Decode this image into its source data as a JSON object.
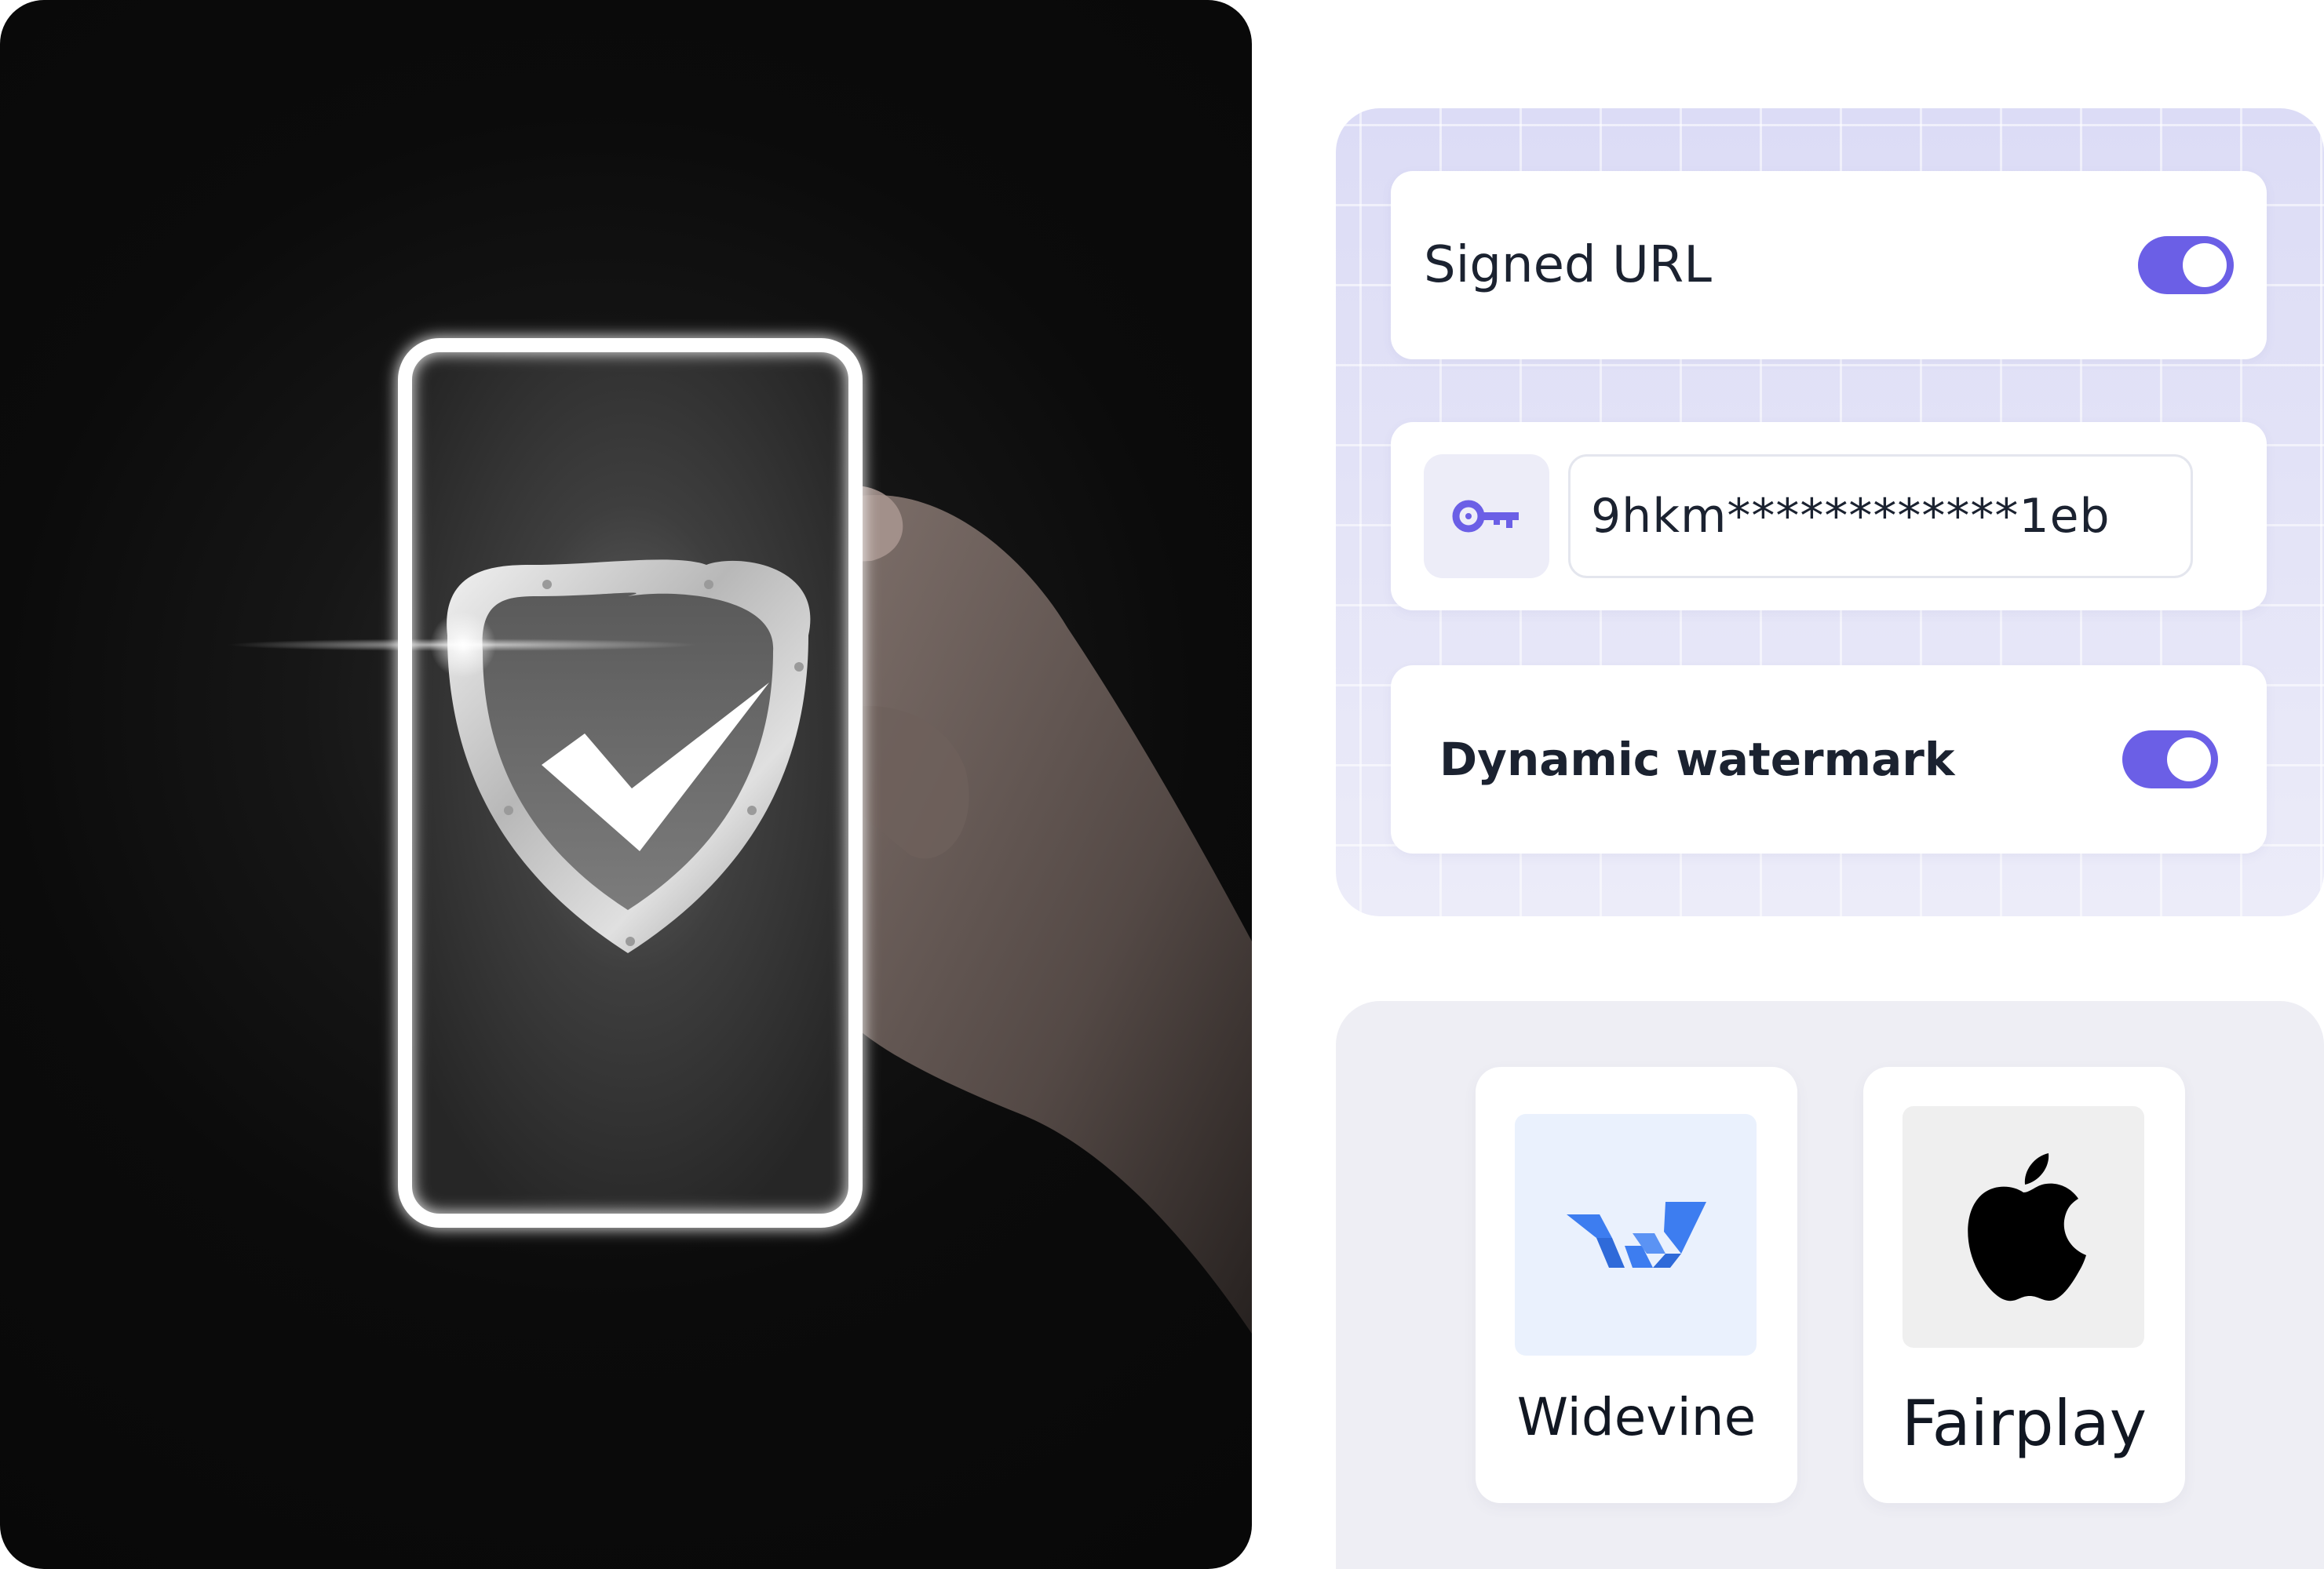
{
  "security": {
    "signed_url": {
      "label": "Signed URL",
      "enabled": true
    },
    "api_key": {
      "icon": "key-icon",
      "value": "9hkm************1eb"
    },
    "dynamic_watermark": {
      "label": "Dynamic watermark",
      "enabled": true
    }
  },
  "drm": {
    "providers": [
      {
        "name": "Widevine",
        "icon": "widevine-logo-icon"
      },
      {
        "name": "Fairplay",
        "icon": "apple-logo-icon"
      }
    ]
  },
  "colors": {
    "accent": "#6b5fe6",
    "hero_background": "#0b0b0b",
    "settings_panel_bg": "#e2e2f7",
    "drm_panel_bg": "#eeeef4",
    "widevine_blue": "#3d7df0",
    "text_dark": "#1b2230"
  }
}
